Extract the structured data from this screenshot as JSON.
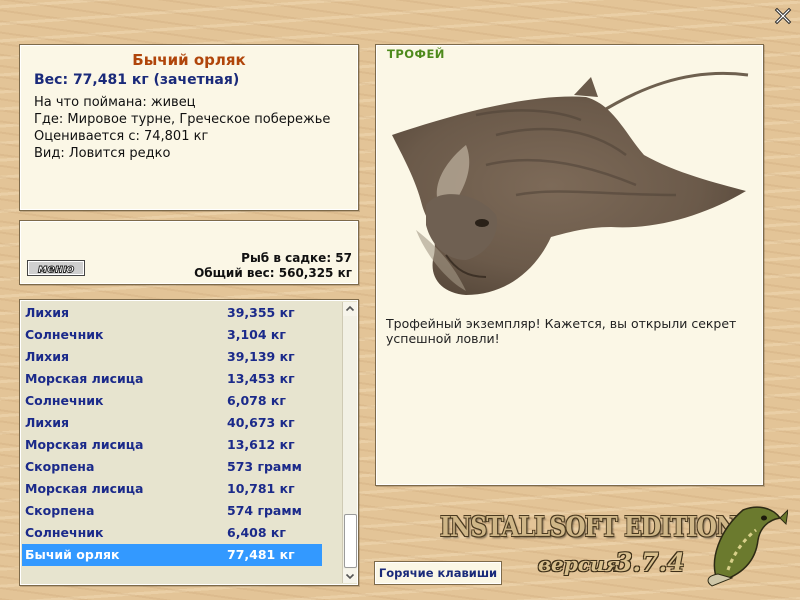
{
  "info": {
    "name": "Бычий орляк",
    "weight": "Вес: 77,481 кг (зачетная)",
    "bait": "На что поймана: живец",
    "where": "Где: Мировое турне, Греческое побережье",
    "value": "Оценивается с: 74,801 кг",
    "kind": "Вид: Ловится редко"
  },
  "menu": {
    "button_label": "меню",
    "catch_count": "Рыб в садке: 57",
    "total_weight": "Общий вес: 560,325 кг"
  },
  "catch_list": [
    {
      "name": "Лихия",
      "weight": "39,355 кг"
    },
    {
      "name": "Солнечник",
      "weight": "3,104 кг"
    },
    {
      "name": "Лихия",
      "weight": "39,139 кг"
    },
    {
      "name": "Морская лисица",
      "weight": "13,453 кг"
    },
    {
      "name": "Солнечник",
      "weight": "6,078 кг"
    },
    {
      "name": "Лихия",
      "weight": "40,673 кг"
    },
    {
      "name": "Морская лисица",
      "weight": "13,612 кг"
    },
    {
      "name": "Скорпена",
      "weight": "573 грамм"
    },
    {
      "name": "Морская лисица",
      "weight": "10,781 кг"
    },
    {
      "name": "Скорпена",
      "weight": "574 грамм"
    },
    {
      "name": "Солнечник",
      "weight": "6,408 кг"
    },
    {
      "name": "Бычий орляк",
      "weight": "77,481 кг"
    }
  ],
  "selected_index": 11,
  "trophy": {
    "label": "ТРОФЕЙ",
    "text": "Трофейный экземпляр! Кажется, вы открыли секрет успешной ловли!"
  },
  "hotkeys_label": "Горячие клавиши",
  "brand": {
    "edition": "INSTALLSOFT EDITION",
    "version_word": "версия",
    "version_number": "3.7.4"
  },
  "icons": {
    "close": "close-icon",
    "menu": "menu-button",
    "fish": "eagle-ray-image",
    "logo": "pike-logo-icon"
  },
  "colors": {
    "name": "#b0450a",
    "weight": "#1a2a7a",
    "list_text": "#1b2a8a",
    "selection": "#3399ff",
    "trophy_label": "#4e8a1c",
    "background": "#e3c497"
  }
}
